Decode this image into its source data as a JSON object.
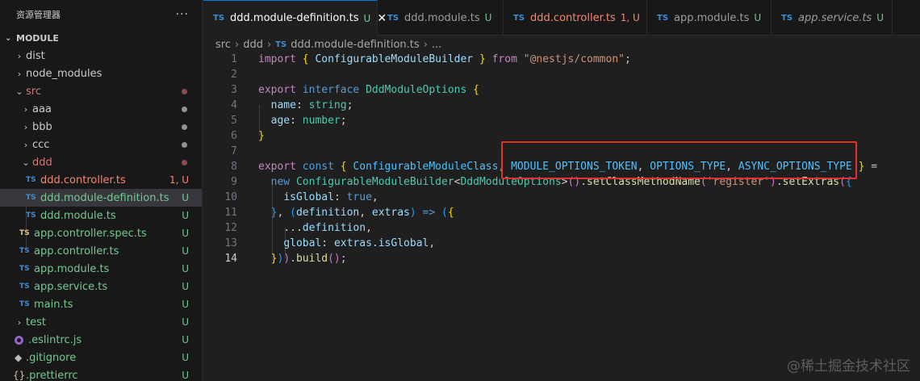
{
  "explorer": {
    "title": "资源管理器",
    "more": "···",
    "section": "MODULE",
    "items": [
      {
        "label": "dist"
      },
      {
        "label": "node_modules"
      },
      {
        "label": "src"
      },
      {
        "label": "aaa"
      },
      {
        "label": "bbb"
      },
      {
        "label": "ccc"
      },
      {
        "label": "ddd"
      },
      {
        "label": "ddd.controller.ts",
        "badge": "1, U"
      },
      {
        "label": "ddd.module-definition.ts",
        "badge": "U"
      },
      {
        "label": "ddd.module.ts",
        "badge": "U"
      },
      {
        "label": "app.controller.spec.ts",
        "badge": "U"
      },
      {
        "label": "app.controller.ts",
        "badge": "U"
      },
      {
        "label": "app.module.ts",
        "badge": "U"
      },
      {
        "label": "app.service.ts",
        "badge": "U"
      },
      {
        "label": "main.ts",
        "badge": "U"
      },
      {
        "label": "test",
        "badge": "U"
      },
      {
        "label": ".eslintrc.js",
        "badge": "U"
      },
      {
        "label": ".gitignore",
        "badge": "U"
      },
      {
        "label": ".prettierrc",
        "badge": "U"
      }
    ]
  },
  "tabs": [
    {
      "label": "ddd.module-definition.ts",
      "status": "U",
      "close": "✕"
    },
    {
      "label": "ddd.module.ts",
      "status": "U"
    },
    {
      "label": "ddd.controller.ts",
      "status": "1, U"
    },
    {
      "label": "app.module.ts",
      "status": "U"
    },
    {
      "label": "app.service.ts",
      "status": "U"
    }
  ],
  "ts_icon": "TS",
  "breadcrumb": {
    "parts": [
      "src",
      "ddd",
      "ddd.module-definition.ts",
      "..."
    ]
  },
  "editor": {
    "line_numbers": [
      "1",
      "2",
      "3",
      "4",
      "5",
      "6",
      "7",
      "8",
      "9",
      "10",
      "11",
      "12",
      "13",
      "14"
    ],
    "l1": {
      "kw": "import",
      "ob": "{",
      "id": "ConfigurableModuleBuilder",
      "cb": "}",
      "from": "from",
      "str": "\"@nestjs/common\"",
      "semi": ";"
    },
    "l3": {
      "kw1": "export",
      "kw2": "interface",
      "name": "DddModuleOptions",
      "ob": "{"
    },
    "l4": {
      "prop": "name",
      "colon": ":",
      "type": "string",
      "semi": ";"
    },
    "l5": {
      "prop": "age",
      "colon": ":",
      "type": "number",
      "semi": ";"
    },
    "l6": {
      "cb": "}"
    },
    "l8": {
      "kw1": "export",
      "kw2": "const",
      "ob": "{",
      "a": "ConfigurableModuleClass",
      "comma1": ",",
      "b": "MODULE_OPTIONS_TOKEN",
      "comma2": ",",
      "c": "OPTIONS_TYPE",
      "comma3": ",",
      "d": "ASYNC_OPTIONS_TYPE",
      "cb": "}",
      "eq": "="
    },
    "l9": {
      "kw": "new",
      "cls": "ConfigurableModuleBuilder",
      "lt": "<",
      "gen": "DddModuleOptions",
      "gt": ">",
      "call1": "()",
      "dot1": ".",
      "m1": "setClassMethodName",
      "op1": "(",
      "str": "'register'",
      "cp1": ")",
      "dot2": ".",
      "m2": "setExtras",
      "op2": "(",
      "ob": "{"
    },
    "l10": {
      "prop": "isGlobal",
      "colon": ":",
      "val": "true",
      "comma": ","
    },
    "l11": {
      "cb": "}",
      "comma": ",",
      "op": "(",
      "p1": "definition",
      "comma2": ",",
      "p2": "extras",
      "cp": ")",
      "arrow": "=>",
      "op2": "(",
      "ob": "{"
    },
    "l12": {
      "spread": "...",
      "id": "definition",
      "comma": ","
    },
    "l13": {
      "prop": "global",
      "colon": ":",
      "obj": "extras",
      "dot": ".",
      "mem": "isGlobal",
      "comma": ","
    },
    "l14": {
      "cb": "}",
      "cp": ")",
      "cp2": ")",
      "dot": ".",
      "m": "build",
      "call": "()",
      "semi": ";"
    }
  },
  "colors": {
    "highlight_box": "#e03030",
    "accent": "#0078d4"
  },
  "watermark": "@稀土掘金技术社区"
}
